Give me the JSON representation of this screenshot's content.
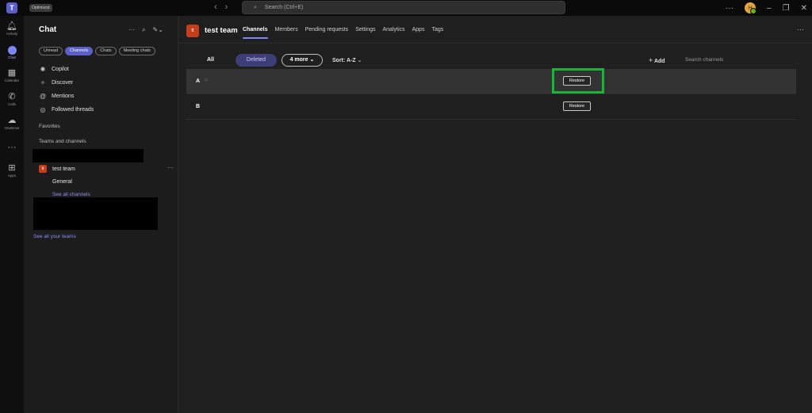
{
  "titlebar": {
    "badge": "Optimized",
    "search_placeholder": "Search (Ctrl+E)",
    "avatar_initials": "H"
  },
  "rail": {
    "items": [
      {
        "label": "Activity"
      },
      {
        "label": "Chat"
      },
      {
        "label": "Calendar"
      },
      {
        "label": "Calls"
      },
      {
        "label": "OneDrive"
      },
      {
        "label": "Apps"
      }
    ]
  },
  "chat_panel": {
    "title": "Chat",
    "filters": [
      "Unread",
      "Channels",
      "Chats",
      "Meeting chats"
    ],
    "nav": [
      "Copilot",
      "Discover",
      "Mentions",
      "Followed threads"
    ],
    "favorites": "Favorites",
    "teams_and_channels": "Teams and channels",
    "team_name": "test team",
    "team_initial": "tt",
    "general": "General",
    "see_all_channels": "See all channels",
    "see_all_teams": "See all your teams"
  },
  "main": {
    "team_initial": "tt",
    "team_name": "test team",
    "tabs": [
      "Channels",
      "Members",
      "Pending requests",
      "Settings",
      "Analytics",
      "Apps",
      "Tags"
    ],
    "filter_all": "All",
    "filter_deleted": "Deleted",
    "filter_more": "4 more",
    "sort": "Sort: A-Z",
    "add": "Add",
    "search_channels": "Search channels",
    "rows": [
      {
        "name": "A",
        "button": "Restore"
      },
      {
        "name": "B",
        "button": "Restore"
      }
    ]
  },
  "colors": {
    "accent": "#5b5fc7",
    "team_avatar": "#c43e1c",
    "highlight": "#1db33a"
  }
}
